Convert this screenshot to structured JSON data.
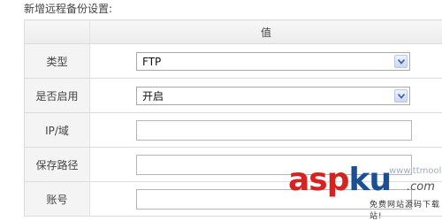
{
  "section": {
    "title": "新增远程备份设置:"
  },
  "table": {
    "header": {
      "label_col": "",
      "value_col": "值"
    },
    "rows": [
      {
        "label": "类型",
        "type": "select",
        "value": "FTP"
      },
      {
        "label": "是否启用",
        "type": "select",
        "value": "开启"
      },
      {
        "label": "IP/域",
        "type": "input",
        "value": ""
      },
      {
        "label": "保存路径",
        "type": "input",
        "value": ""
      },
      {
        "label": "账号",
        "type": "input",
        "value": ""
      }
    ]
  },
  "watermark": {
    "logo_main": "asp",
    "logo_accent": "ku",
    "tld": ".com",
    "handle": "www.ttmool2",
    "tagline": "免费网站源码下载站!"
  },
  "colors": {
    "table_border": "#dcdcdc",
    "label_bg": "#f4f4f4",
    "watermark_red": "#d8221f",
    "watermark_blue": "#1a4f96"
  },
  "icons": {
    "select_arrow": "chevron-down-icon"
  }
}
